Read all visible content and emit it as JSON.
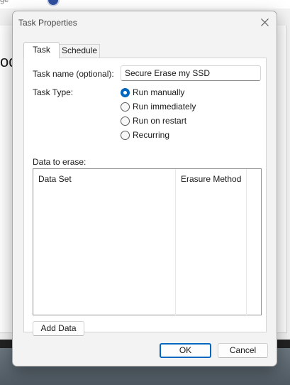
{
  "background": {
    "top_text": "ge",
    "app_text": "od"
  },
  "dialog": {
    "title": "Task Properties",
    "tabs": [
      {
        "label": "Task",
        "active": true
      },
      {
        "label": "Schedule",
        "active": false
      }
    ],
    "task_name": {
      "label": "Task name (optional):",
      "value": "Secure Erase my SSD"
    },
    "task_type": {
      "label": "Task Type:",
      "options": [
        {
          "label": "Run manually",
          "checked": true
        },
        {
          "label": "Run immediately",
          "checked": false
        },
        {
          "label": "Run on restart",
          "checked": false
        },
        {
          "label": "Recurring",
          "checked": false
        }
      ]
    },
    "data_to_erase": {
      "label": "Data to erase:",
      "columns": [
        "Data Set",
        "Erasure Method"
      ],
      "rows": []
    },
    "add_data_label": "Add Data",
    "ok_label": "OK",
    "cancel_label": "Cancel"
  },
  "colors": {
    "accent": "#0067c0",
    "dialog_bg": "#f3f3f3",
    "panel_bg": "#ffffff"
  }
}
